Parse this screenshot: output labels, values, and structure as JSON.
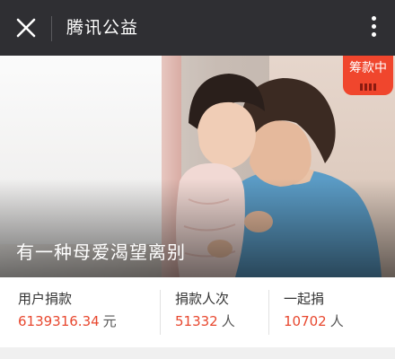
{
  "app": {
    "title": "腾讯公益"
  },
  "header": {
    "close_icon": "close-icon",
    "more_icon": "more-vertical-icon"
  },
  "project": {
    "caption": "有一种母爱渴望离别",
    "status_badge": "筹款中",
    "badge_color": "#f0462d"
  },
  "stats": [
    {
      "label": "用户捐款",
      "value": "6139316.34",
      "unit": "元"
    },
    {
      "label": "捐款人次",
      "value": "51332",
      "unit": "人"
    },
    {
      "label": "一起捐",
      "value": "10702",
      "unit": "人"
    }
  ],
  "colors": {
    "topbar": "#2f2f33",
    "accent_number": "#e8472e"
  }
}
